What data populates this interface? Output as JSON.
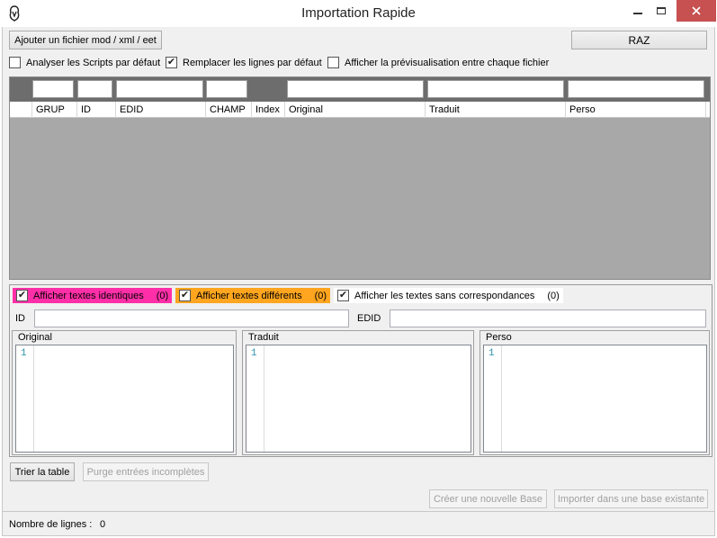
{
  "window": {
    "title": "Importation Rapide"
  },
  "toolbar": {
    "add_file_label": "Ajouter un fichier mod / xml / eet",
    "reset_label": "RAZ"
  },
  "options": {
    "analyze_scripts": {
      "label": "Analyser les Scripts par défaut",
      "checked": false
    },
    "replace_lines": {
      "label": "Remplacer les lignes par défaut",
      "checked": true
    },
    "preview": {
      "label": "Afficher la prévisualisation entre chaque fichier",
      "checked": false
    }
  },
  "grid": {
    "columns": [
      "GRUP",
      "ID",
      "EDID",
      "CHAMP",
      "Index",
      "Original",
      "Traduit",
      "Perso"
    ]
  },
  "filters": {
    "identical": {
      "label": "Afficher textes identiques",
      "count": "(0)",
      "checked": true,
      "color": "#ff2fa8"
    },
    "different": {
      "label": "Afficher textes différents",
      "count": "(0)",
      "checked": true,
      "color": "#ffa51f"
    },
    "unmatched": {
      "label": "Afficher les textes sans correspondances",
      "count": "(0)",
      "checked": true
    }
  },
  "detail": {
    "id_label": "ID",
    "edid_label": "EDID",
    "original_title": "Original",
    "traduit_title": "Traduit",
    "perso_title": "Perso",
    "line_number": "1"
  },
  "actions": {
    "sort_label": "Trier la table",
    "purge_label": "Purge entrées incomplètes",
    "new_base_label": "Créer une nouvelle Base",
    "import_label": "Importer dans une base existante"
  },
  "status": {
    "rows_label": "Nombre de lignes :",
    "rows_value": "0"
  }
}
